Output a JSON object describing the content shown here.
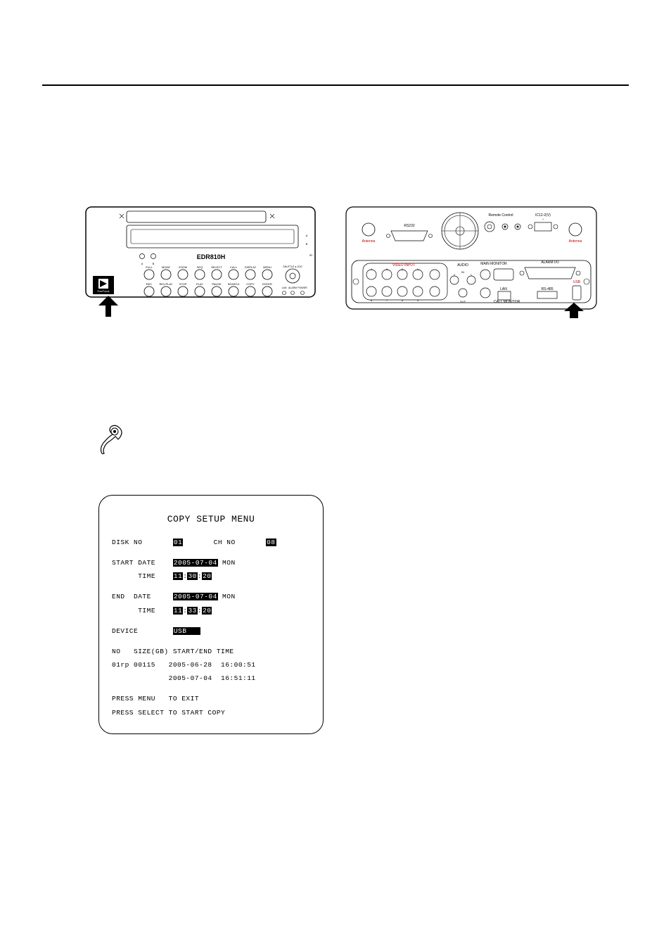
{
  "diagrams": {
    "front": {
      "model": "EDR810H",
      "buttons": [
        "FULL",
        "MODE",
        "ZOOM",
        "SEQ",
        "SELECT",
        "CALL",
        "DISPLAY",
        "MENU"
      ],
      "buttons2": [
        "REC",
        "REV.PLAY",
        "STOP",
        "PLAY",
        "PAUSE",
        "SEARCH",
        "COPY",
        "ENTER"
      ],
      "shuttle": "SHUTTLE ● JOG",
      "leds": [
        "LAN",
        "ALARM",
        "POWER"
      ],
      "brand": "EverFocus"
    },
    "rear": {
      "labels": {
        "remote": "Remote Control",
        "ic12": "IC12-2(V)",
        "rs232": "RS232",
        "antenna": "Antenna",
        "video_input": "VIDEO INPUT",
        "audio": "AUDIO",
        "in": "IN",
        "main_monitor": "MAIN MONITOR",
        "call_monitor": "CALL MONITOR",
        "alarm_io": "ALARM I/O",
        "lan": "LAN",
        "rs485": "RS-485",
        "usb": "USB",
        "out": "OUT"
      }
    }
  },
  "menu": {
    "title": "COPY SETUP MENU",
    "disk_no_label": "DISK NO",
    "disk_no_value": "01",
    "ch_no_label": "CH NO",
    "ch_no_value": "08",
    "start_date_label": "START DATE",
    "start_date_value": "2005-07-04",
    "start_day": "MON",
    "start_time_label": "TIME",
    "start_time_h": "11",
    "start_time_m": "30",
    "start_time_s": "20",
    "end_date_label": "END  DATE",
    "end_date_value": "2005-07-04",
    "end_day": "MON",
    "end_time_label": "TIME",
    "end_time_h": "11",
    "end_time_m": "33",
    "end_time_s": "20",
    "device_label": "DEVICE",
    "device_value": "USB",
    "table_header": "NO   SIZE(GB) START/END TIME",
    "table_row1": "01rp 00115   2005-06-28  16:00:51",
    "table_row2": "             2005-07-04  16:51:11",
    "hint1": "PRESS MENU   TO EXIT",
    "hint2": "PRESS SELECT TO START COPY"
  }
}
